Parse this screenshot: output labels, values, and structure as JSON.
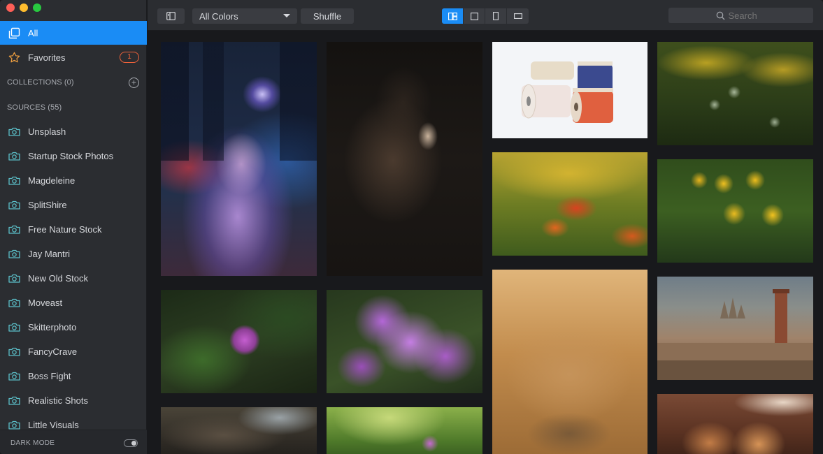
{
  "sidebar": {
    "all_label": "All",
    "favorites_label": "Favorites",
    "favorites_count": "1",
    "collections_label": "COLLECTIONS (0)",
    "sources_label": "SOURCES (55)",
    "sources": [
      "Unsplash",
      "Startup Stock Photos",
      "Magdeleine",
      "SplitShire",
      "Free Nature Stock",
      "Jay Mantri",
      "New Old Stock",
      "Moveast",
      "Skitterphoto",
      "FancyCrave",
      "Boss Fight",
      "Realistic Shots",
      "Little Visuals"
    ],
    "dark_mode_label": "DARK MODE",
    "dark_mode_on": true
  },
  "toolbar": {
    "color_filter": "All Colors",
    "shuffle_label": "Shuffle",
    "search_placeholder": "Search",
    "view_modes": [
      "masonry",
      "square",
      "portrait",
      "landscape"
    ],
    "active_view": "masonry"
  },
  "colors": {
    "accent": "#1a8cf5",
    "badge": "#f0623a",
    "sidebar_bg": "#2b2d31",
    "content_bg": "#18191c"
  },
  "photos": [
    "neon-city-woman-raincoat",
    "dark-portrait-hand",
    "thread-spools",
    "poppy-seed-pods",
    "pink-single-flower",
    "purple-phlox-flowers",
    "orange-marigolds",
    "grasshopper-on-leaf",
    "yellow-daisies",
    "barcelona-skyline-chimney",
    "tree-roots-water",
    "pink-blossom-bokeh",
    "macarons-on-plate"
  ]
}
